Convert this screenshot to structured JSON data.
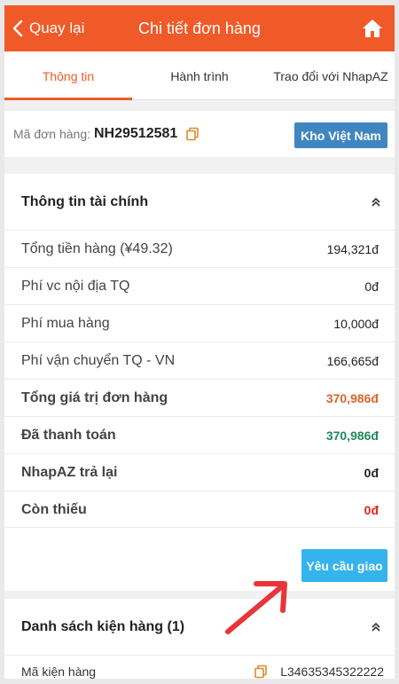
{
  "header": {
    "back_label": "Quay lại",
    "title": "Chi tiết đơn hàng",
    "background": "#f05a28"
  },
  "tabs": [
    {
      "label": "Thông tin",
      "active": true
    },
    {
      "label": "Hành trình",
      "active": false
    },
    {
      "label": "Trao đổi với NhapAZ",
      "active": false
    }
  ],
  "order": {
    "code_label": "Mã đơn hàng:",
    "code": "NH29512581",
    "warehouse_button": "Kho Việt Nam"
  },
  "finance": {
    "title": "Thông tin tài chính",
    "rows": [
      {
        "label": "Tổng tiền hàng (¥49.32)",
        "value": "194,321đ"
      },
      {
        "label": "Phí vc nội địa TQ",
        "value": "0đ"
      },
      {
        "label": "Phí mua hàng",
        "value": "10,000đ"
      },
      {
        "label": "Phí vận chuyển TQ - VN",
        "value": "166,665đ"
      },
      {
        "label": "Tổng giá trị đơn hàng",
        "value": "370,986đ",
        "color": "#d9662b"
      },
      {
        "label": "Đã thanh toán",
        "value": "370,986đ",
        "color": "#1e8a5a"
      },
      {
        "label": "NhapAZ trả lại",
        "value": "0đ",
        "color": "#222222"
      },
      {
        "label": "Còn thiếu",
        "value": "0đ",
        "color": "#e0251b"
      }
    ],
    "request_button": "Yêu cầu giao"
  },
  "packages": {
    "title": "Danh sách kiện hàng (1)",
    "code_label": "Mã kiện hàng",
    "code": "L34635345322222"
  },
  "colors": {
    "accent": "#f05a28",
    "warehouse_btn": "#3f86c1",
    "request_btn": "#35b3ec",
    "annotation_arrow": "#e8343a"
  }
}
